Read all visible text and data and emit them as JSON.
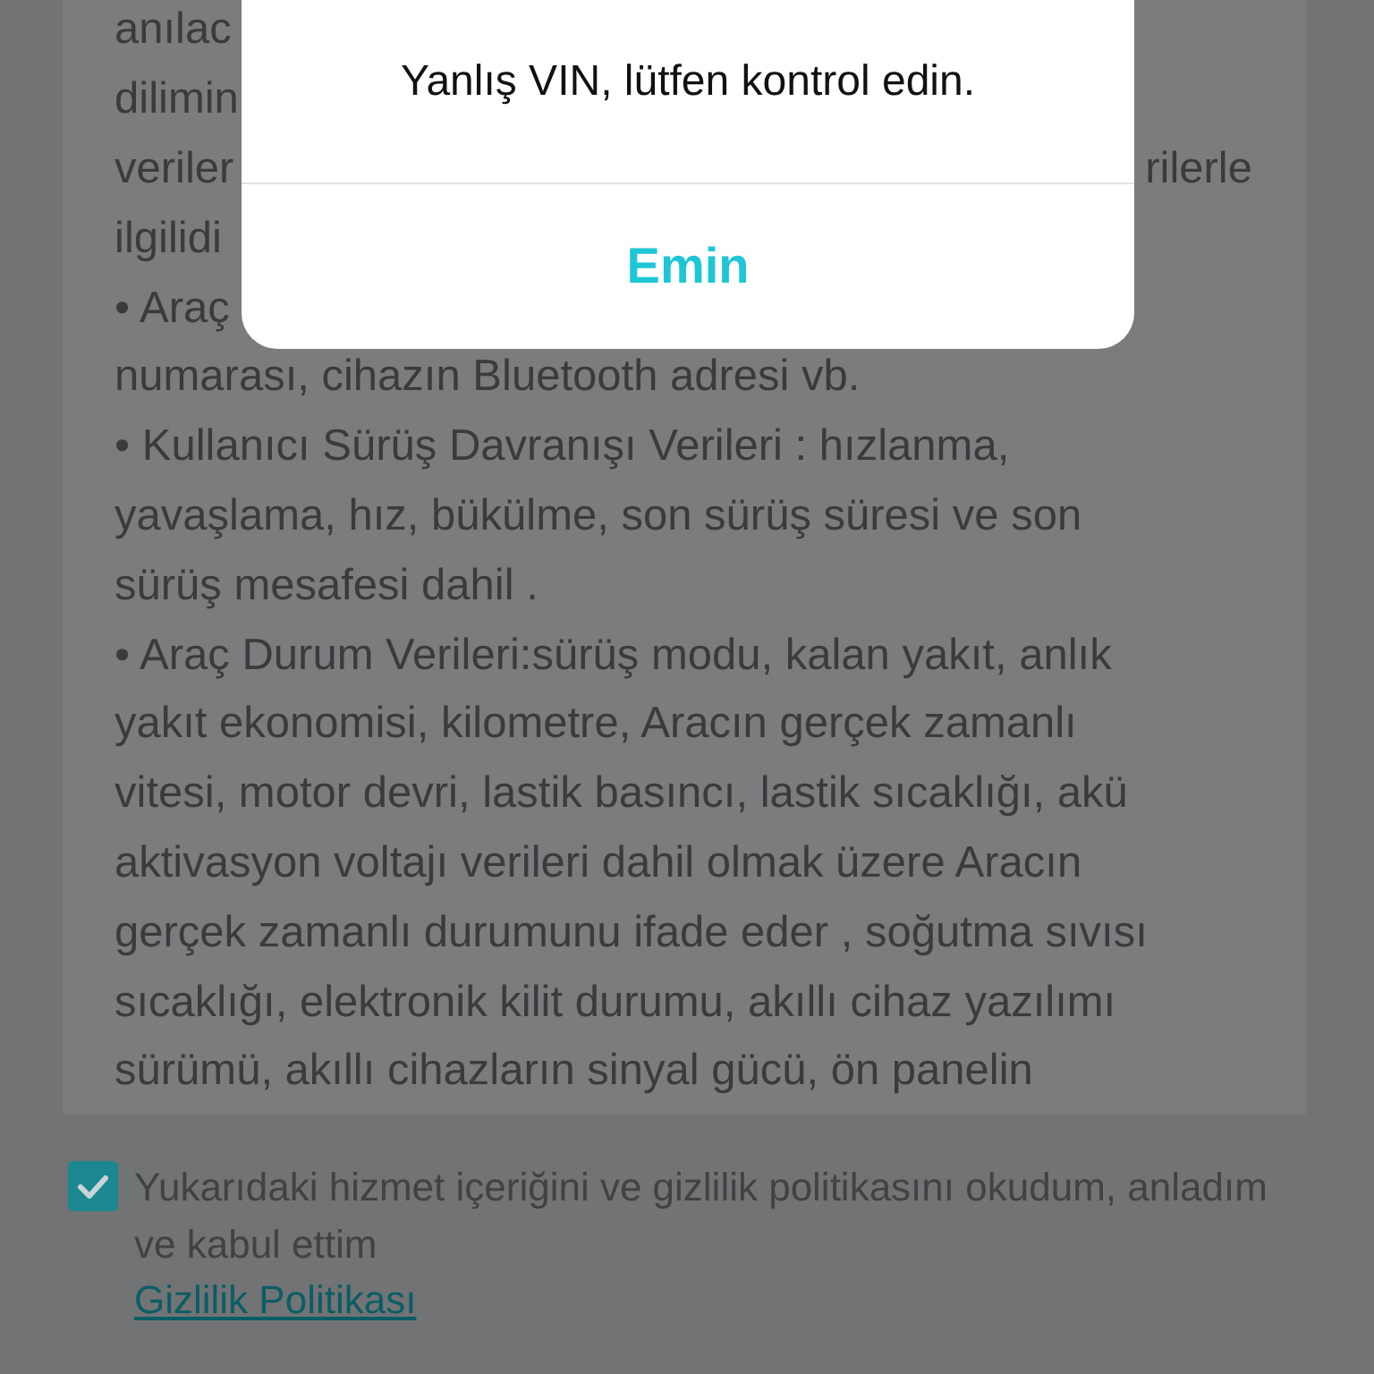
{
  "content": {
    "lines": [
      {
        "left": "anılac"
      },
      {
        "left": "dilimin"
      },
      {
        "left": "veriler",
        "right": "rilerle"
      },
      {
        "left": "ilgilidi"
      },
      {
        "left": "• Araç"
      },
      {
        "left": "numarası, cihazın Bluetooth adresi vb."
      },
      {
        "left": "• Kullanıcı Sürüş Davranışı Verileri : hızlanma,"
      },
      {
        "left": "yavaşlama, hız, bükülme, son sürüş süresi ve son"
      },
      {
        "left": "sürüş mesafesi dahil ."
      },
      {
        "left": "• Araç Durum Verileri:sürüş modu, kalan yakıt, anlık"
      },
      {
        "left": "yakıt ekonomisi, kilometre, Aracın gerçek zamanlı"
      },
      {
        "left": "vitesi, motor devri, lastik basıncı, lastik sıcaklığı, akü"
      },
      {
        "left": "aktivasyon voltajı verileri dahil olmak üzere Aracın"
      },
      {
        "left": "gerçek zamanlı durumunu ifade eder , soğutma sıvısı"
      },
      {
        "left": "sıcaklığı, elektronik kilit durumu, akıllı cihaz yazılımı"
      },
      {
        "left": "sürümü, akıllı cihazların sinyal gücü, ön panelin"
      }
    ]
  },
  "agreement": {
    "checked": true,
    "text": "Yukarıdaki hizmet içeriğini ve gizlilik politikasını okudum, anladım ve kabul ettim",
    "link": "Gizlilik Politikası"
  },
  "dialog": {
    "message": "Yanlış VIN, lütfen kontrol edin.",
    "button": "Emin"
  }
}
